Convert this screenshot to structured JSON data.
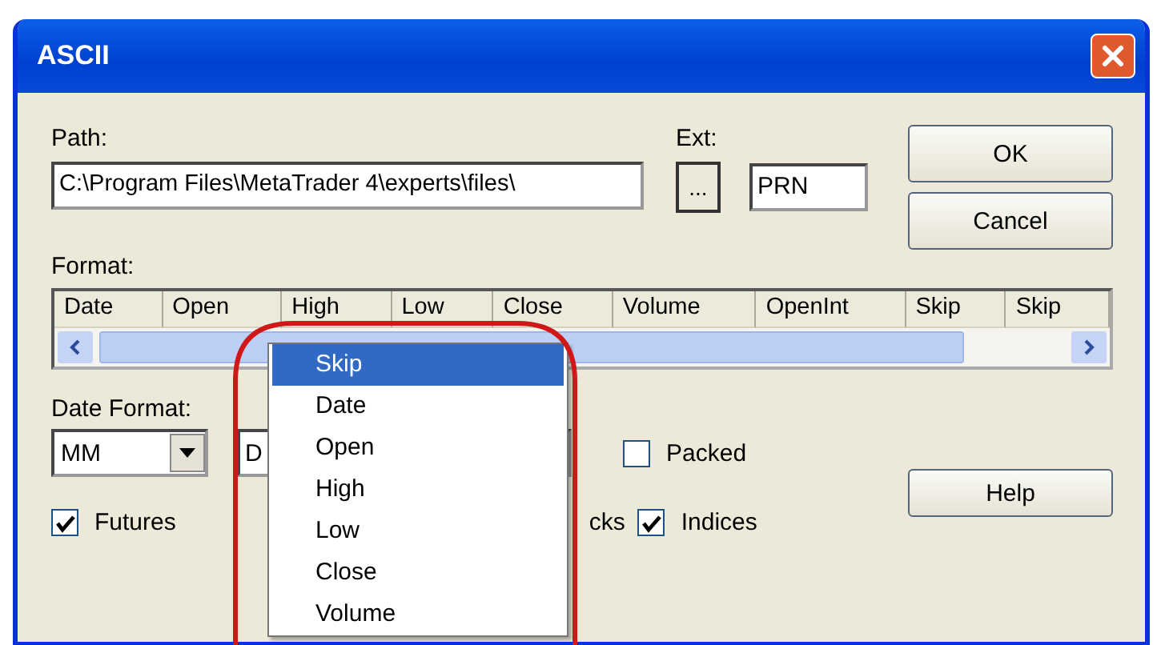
{
  "window": {
    "title": "ASCII"
  },
  "path": {
    "label": "Path:",
    "value": "C:\\Program Files\\MetaTrader 4\\experts\\files\\"
  },
  "ext": {
    "label": "Ext:",
    "browse": "...",
    "value": "PRN"
  },
  "buttons": [
    "OK",
    "Cancel"
  ],
  "format": {
    "label": "Format:",
    "columns": [
      "Date",
      "Open",
      "High",
      "Low",
      "Close",
      "Volume",
      "OpenInt",
      "Skip",
      "Skip"
    ]
  },
  "date_format": {
    "label": "Date Format:",
    "combo_1": "MM",
    "combo_2": "D"
  },
  "checkboxes": [
    {
      "label": "Packed",
      "checked": false
    },
    {
      "label": "Futures",
      "checked": true
    },
    {
      "label": "Indices",
      "checked": true
    }
  ],
  "partial_label": "cks",
  "help": "Help",
  "dropdown": {
    "items": [
      {
        "label": "Skip",
        "selected": true
      },
      {
        "label": "Date",
        "selected": false
      },
      {
        "label": "Open",
        "selected": false
      },
      {
        "label": "High",
        "selected": false
      },
      {
        "label": "Low",
        "selected": false
      },
      {
        "label": "Close",
        "selected": false
      },
      {
        "label": "Volume",
        "selected": false
      }
    ]
  }
}
